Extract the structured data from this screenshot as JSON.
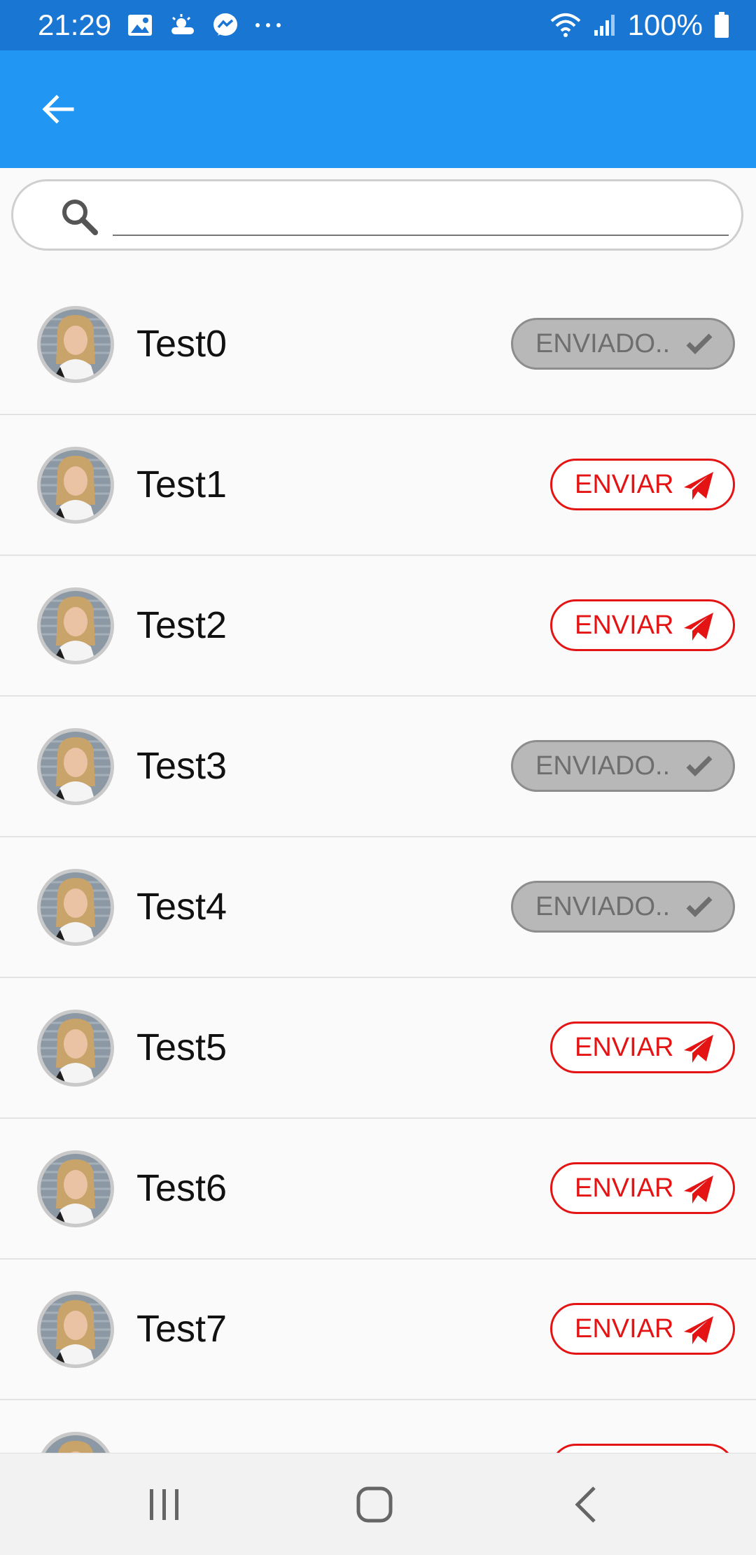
{
  "status_bar": {
    "time": "21:29",
    "battery": "100%",
    "notification_icons": [
      "gallery-icon",
      "weather-icon",
      "messenger-icon",
      "more-dots-icon"
    ],
    "system_icons": [
      "wifi-icon",
      "signal-icon",
      "battery-icon"
    ]
  },
  "app_bar": {
    "back_icon": "arrow-back-icon",
    "color": "#2196f3"
  },
  "search": {
    "placeholder": "",
    "value": "",
    "icon": "search-icon"
  },
  "contacts": [
    {
      "name": "Test0",
      "button_label": "ENVIADO..",
      "state": "sent"
    },
    {
      "name": "Test1",
      "button_label": "ENVIAR",
      "state": "send"
    },
    {
      "name": "Test2",
      "button_label": "ENVIAR",
      "state": "send"
    },
    {
      "name": "Test3",
      "button_label": "ENVIADO..",
      "state": "sent"
    },
    {
      "name": "Test4",
      "button_label": "ENVIADO..",
      "state": "sent"
    },
    {
      "name": "Test5",
      "button_label": "ENVIAR",
      "state": "send"
    },
    {
      "name": "Test6",
      "button_label": "ENVIAR",
      "state": "send"
    },
    {
      "name": "Test7",
      "button_label": "ENVIAR",
      "state": "send"
    }
  ],
  "colors": {
    "send": "#e51414",
    "sent_bg": "#b8b8b8",
    "sent_text": "#6e6e6e",
    "status_bar": "#1976d2"
  },
  "nav_bar": {
    "buttons": [
      "recent-apps-icon",
      "home-icon",
      "back-icon"
    ]
  }
}
